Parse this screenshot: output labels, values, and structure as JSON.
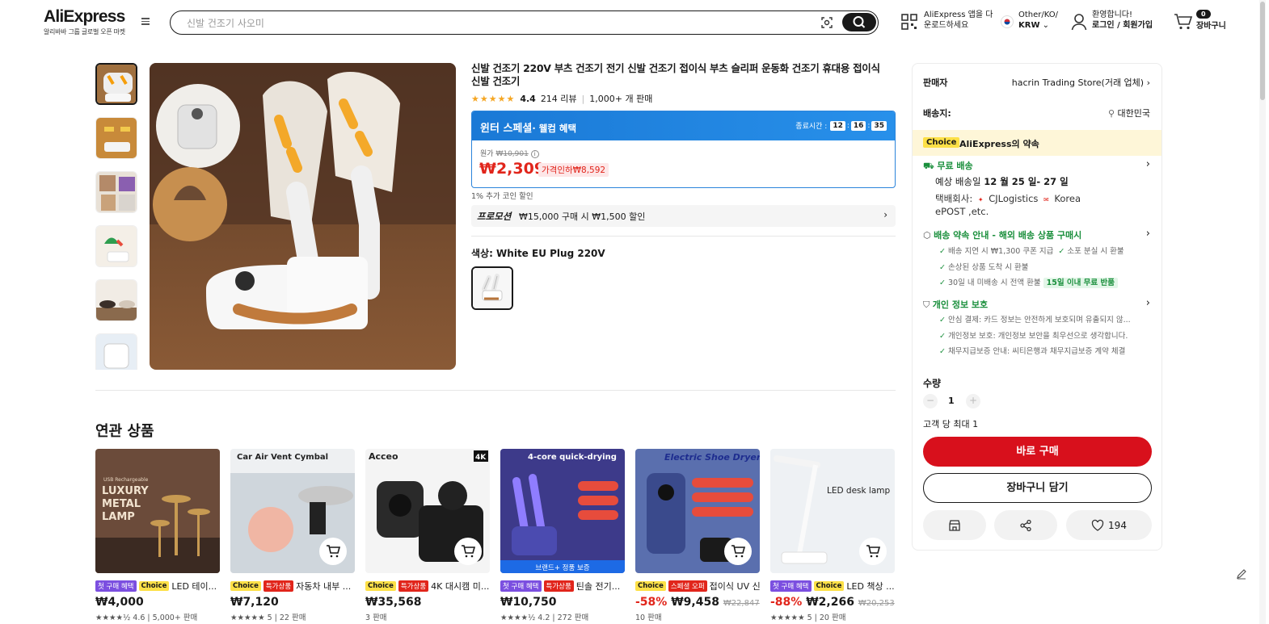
{
  "header": {
    "logo": "AliExpress",
    "logo_tagline": "알리바바 그룹 글로벌 오픈 마켓",
    "search_placeholder": "신발 건조기 사오미",
    "app_download_line1": "AliExpress 앱을 다",
    "app_download_line2": "운로드하세요",
    "region_line1": "Other/KO/",
    "region_line2": "KRW",
    "greeting": "환영합니다!",
    "login_label": "로그인 / 회원가입",
    "cart_count": "0",
    "cart_label": "장바구니"
  },
  "product": {
    "title": "신발 건조기 220V 부츠 건조기 전기 신발 건조기 접이식 부츠 슬리퍼 운동화 건조기 휴대용 접이식 신발 건조기",
    "stars": "★★★★★",
    "rating": "4.4",
    "reviews": "214 리뷰",
    "sold": "1,000+ 개 판매",
    "sale_title": "윈터 스페셜",
    "sale_subtitle": "· 웰컴 혜택",
    "timer_label": "종료시간 :",
    "timer_h": "12",
    "timer_m": "16",
    "timer_s": "35",
    "orig_label": "원가",
    "orig_price": "₩10,901",
    "price": "₩2,309",
    "discount_tag": "가격인하₩8,592",
    "coin_note": "1% 추가 코인 할인",
    "promo_label": "프로모션",
    "promo_text": "₩15,000 구매 시 ₩1,500 할인",
    "color_label": "색상: White EU Plug 220V"
  },
  "panel": {
    "seller_label": "판매자",
    "seller_name": "hacrin Trading Store(거래 업체)",
    "ship_label": "배송지:",
    "ship_value": "대한민국",
    "choice_tag": "Choice",
    "choice_text": "AliExpress의 약속",
    "free_ship": "무료 배송",
    "eta_prefix": "예상 배송일",
    "eta_dates": "12 월 25 일- 27 일",
    "carrier_label": "택배회사:",
    "carrier_1": "CJLogistics",
    "carrier_2": "Korea",
    "carrier_3": "ePOST ,etc.",
    "promise_title": "배송 약속 안내 - 해외 배송 상품 구매시",
    "promise_1a": "배송 지연 시 ₩1,300 쿠폰 지급",
    "promise_1b": "소포 분실 시 환불",
    "promise_2": "손상된 상품 도착 시 환불",
    "promise_3": "30일 내 미배송 시 전액 환불",
    "promise_3_tag": "15일 이내 무료 반품",
    "privacy_title": "개인 정보 보호",
    "privacy_1": "안심 결제: 카드 정보는 안전하게 보호되며 유출되지 않...",
    "privacy_2": "개인정보 보호: 개인정보 보안을 최우선으로 생각합니다.",
    "privacy_3": "채무지급보증 안내: 씨티은행과 채무지급보증 계약 체결",
    "qty_label": "수량",
    "qty_value": "1",
    "qty_minus": "−",
    "qty_plus": "+",
    "limit": "고객 당 최대 1",
    "buy_now": "바로 구매",
    "add_cart": "장바구니 담기",
    "wish_count": "194"
  },
  "related": {
    "title": "연관 상품",
    "items": [
      {
        "tag1": "첫 구매 혜택",
        "tag2": "Choice",
        "name": "LED 테이...",
        "pct": "",
        "price": "₩4,000",
        "orig": "",
        "meta": "★★★★½ 4.6 | 5,000+ 판매",
        "img_text": "USB Rechargeable LUXURY METAL LAMP"
      },
      {
        "tag1": "Choice",
        "tag2": "특가상품",
        "name": "자동차 내부 ...",
        "pct": "",
        "price": "₩7,120",
        "orig": "",
        "meta": "★★★★★ 5 | 22 판매",
        "img_text": "Car Air Vent Cymbal"
      },
      {
        "tag1": "Choice",
        "tag2": "특가상품",
        "name": "4K 대시캠 미...",
        "pct": "",
        "price": "₩35,568",
        "orig": "",
        "meta": "3 판매",
        "img_text": "Acceo 4K"
      },
      {
        "tag1": "첫 구매 혜택",
        "tag2": "특가상품",
        "name": "틴솔 전기...",
        "pct": "",
        "price": "₩10,750",
        "orig": "",
        "meta": "★★★★½ 4.2 | 272 판매",
        "img_text": "4-core quick-drying",
        "img_band": "브랜드+ 정품 보증"
      },
      {
        "tag1": "Choice",
        "tag2": "스페셜 오퍼",
        "name": "접이식 UV 신...",
        "pct": "-58%",
        "price": "₩9,458",
        "orig": "₩22,847",
        "meta": "10 판매",
        "img_text": "Electric Shoe Dryer"
      },
      {
        "tag1": "첫 구매 혜택",
        "tag2": "Choice",
        "name": "LED 책상 ...",
        "pct": "-88%",
        "price": "₩2,266",
        "orig": "₩20,253",
        "meta": "★★★★★ 5 | 20 판매",
        "img_text": "LED desk lamp"
      }
    ]
  },
  "colors": {
    "accent_red": "#e1251b",
    "buy_red": "#d8101c",
    "sale_blue": "#1a79d6",
    "choice_yellow": "#fde047",
    "green": "#1a8f3c"
  }
}
